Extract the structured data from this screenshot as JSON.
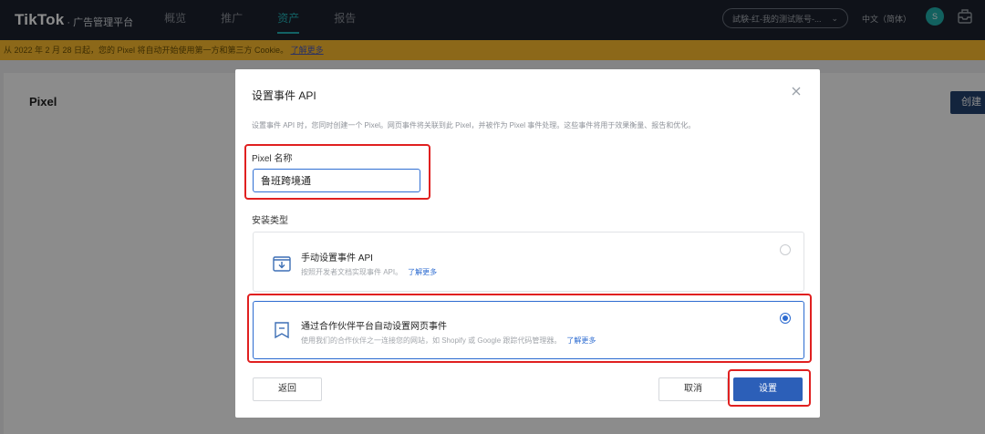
{
  "topbar": {
    "brand": "TikTok",
    "brand_sub": "· 广告管理平台",
    "nav": [
      {
        "label": "概览",
        "active": false
      },
      {
        "label": "推广",
        "active": false
      },
      {
        "label": "资产",
        "active": true
      },
      {
        "label": "报告",
        "active": false
      }
    ],
    "account": "試験-红-我的测试账号-...",
    "language": "中文（简体）",
    "avatar_initial": "S"
  },
  "notice": {
    "text": "从 2022 年 2 月 28 日起，您的 Pixel 将自动开始使用第一方和第三方 Cookie。",
    "link": "了解更多"
  },
  "page": {
    "title": "Pixel",
    "create_button": "创建"
  },
  "modal": {
    "title": "设置事件 API",
    "description": "设置事件 API 时，您同时创建一个 Pixel。网页事件将关联到此 Pixel，并被作为 Pixel 事件处理。这些事件将用于效果衡量、报告和优化。",
    "pixel_name_label": "Pixel 名称",
    "pixel_name_value": "鲁班跨境通",
    "install_type_label": "安装类型",
    "options": [
      {
        "title": "手动设置事件 API",
        "desc": "按照开发者文档实现事件 API。",
        "link": "了解更多",
        "selected": false
      },
      {
        "title": "通过合作伙伴平台自动设置网页事件",
        "desc": "使用我们的合作伙伴之一连接您的网站，如 Shopify 或 Google 跟踪代码管理器。",
        "link": "了解更多",
        "selected": true
      }
    ],
    "back_button": "返回",
    "cancel_button": "取消",
    "confirm_button": "设置"
  },
  "colors": {
    "topbar_bg": "#1c222e",
    "accent": "#24b3b8",
    "notice_bg": "#ffbd2e",
    "primary": "#2c5fb8",
    "highlight": "#e02020"
  }
}
